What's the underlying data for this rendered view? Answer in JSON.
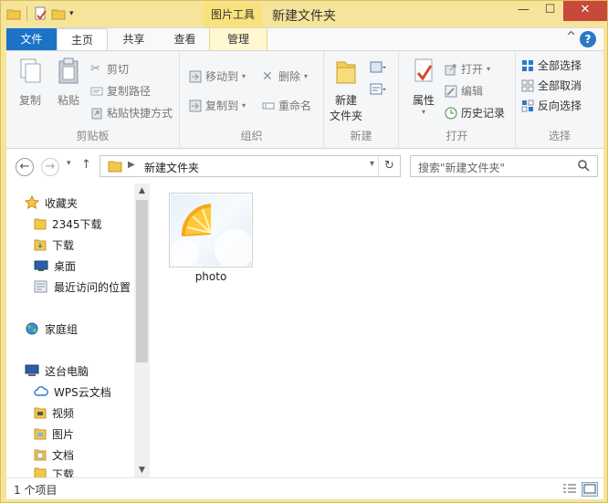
{
  "window": {
    "title": "新建文件夹",
    "context_tab": "图片工具",
    "controls": {
      "minimize": "—",
      "maximize": "☐",
      "close": "✕"
    }
  },
  "quick_access": {
    "dropdown": "▾"
  },
  "tabs": {
    "file": "文件",
    "home": "主页",
    "share": "共享",
    "view": "查看",
    "manage": "管理",
    "help": "?",
    "collapse": "^"
  },
  "ribbon": {
    "clipboard": {
      "label": "剪贴板",
      "copy": "复制",
      "paste": "粘贴",
      "cut": "剪切",
      "copy_path": "复制路径",
      "paste_shortcut": "粘贴快捷方式"
    },
    "organize": {
      "label": "组织",
      "move_to": "移动到",
      "copy_to": "复制到",
      "delete": "删除",
      "rename": "重命名"
    },
    "new": {
      "label": "新建",
      "new_folder_line1": "新建",
      "new_folder_line2": "文件夹"
    },
    "open": {
      "label": "打开",
      "properties": "属性",
      "open": "打开",
      "edit": "编辑",
      "history": "历史记录"
    },
    "select": {
      "label": "选择",
      "select_all": "全部选择",
      "select_none": "全部取消",
      "invert": "反向选择"
    }
  },
  "address": {
    "path": "新建文件夹",
    "search_placeholder": "搜索\"新建文件夹\""
  },
  "nav": {
    "favorites": "收藏夹",
    "fav_items": [
      "2345下载",
      "下载",
      "桌面",
      "最近访问的位置"
    ],
    "homegroup": "家庭组",
    "this_pc": "这台电脑",
    "pc_items": [
      "WPS云文档",
      "视频",
      "图片",
      "文档",
      "下载"
    ]
  },
  "files": [
    {
      "name": "photo"
    }
  ],
  "status": {
    "count": "1 个项目"
  }
}
